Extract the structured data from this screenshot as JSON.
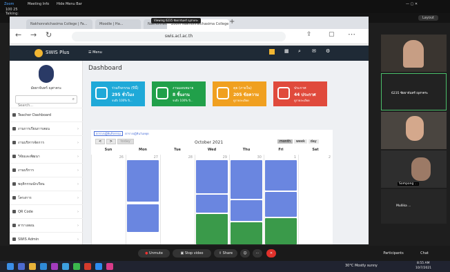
{
  "zoom": {
    "top_left_texts": [
      "Zoom",
      "Meeting Info",
      "Hide Menu Bar"
    ],
    "menu": [
      "Audio & Video",
      "Participant",
      "Meeting",
      "Help"
    ],
    "time_text": "100 25",
    "talking_label": "Talking:",
    "layout_button": "Layout"
  },
  "browser": {
    "tabs": [
      "Nakhonratchasima College | Fa...",
      "Moodle | Ha...",
      "Nakhonratchasima Co...",
      "Zoom Nakhonratchasima College"
    ],
    "url": "swis.acl.ac.th",
    "screen_banner": "Viewing 6235 ชัยยาจันทร์ ญุสาคระ"
  },
  "app": {
    "logo": "SWIS Plus",
    "menu_label": "Menu",
    "dashboard_title": "Dashboard",
    "user_name": "มัยยาจันทร์ ญุสาคระ",
    "search_placeholder": "Search...",
    "sidebar": [
      {
        "label": "Teacher Dashboard",
        "icon": "dashboard-icon"
      },
      {
        "label": "งานการเรียนการสอน",
        "icon": "book-icon"
      },
      {
        "label": "งานบริหารจัดการ",
        "icon": "grid-icon"
      },
      {
        "label": "วิจัยและพัฒนา",
        "icon": "doc-icon"
      },
      {
        "label": "งานบริการ",
        "icon": "list-icon"
      },
      {
        "label": "พฤติกรรมนักเรียน",
        "icon": "user-icon"
      },
      {
        "label": "โครงการ",
        "icon": "folder-icon"
      },
      {
        "label": "QR Code",
        "icon": "qr-icon"
      },
      {
        "label": "ตารางสอน",
        "icon": "calendar-icon"
      },
      {
        "label": "SWIS Admin",
        "icon": "gear-icon"
      }
    ]
  },
  "cards": [
    {
      "title": "ร่วมกิจกรรม (ปีนี้)",
      "value": "295 ชั่วโมง",
      "sub": "จบถึง 100% ปี...",
      "color": "#1fa9d8"
    },
    {
      "title": "งานมอบหมาย",
      "value": "8 ชิ้นงาน",
      "sub": "จบถึง 100% ปี...",
      "color": "#21a04a"
    },
    {
      "title": "คุย (ภายใน)",
      "value": "205 ข้อความ",
      "sub": "ดูรายละเอียด",
      "color": "#f0a020"
    },
    {
      "title": "ประกาศ",
      "value": "44 ประกาศ",
      "sub": "ดูรายละเอียด",
      "color": "#e04a3c"
    }
  ],
  "calendar": {
    "toggle": [
      "ตารางปฏิทินกิจกรรม",
      "ตารางปฏิทินวันหยุด"
    ],
    "nav": [
      "<",
      ">",
      "today"
    ],
    "month": "October 2021",
    "views": [
      "month",
      "week",
      "day"
    ],
    "days": [
      "Sun",
      "Mon",
      "Tue",
      "Wed",
      "Thu",
      "Fri",
      "Sat"
    ],
    "dates": [
      "26",
      "27",
      "28",
      "29",
      "30",
      "1",
      "2"
    ]
  },
  "participants": [
    {
      "name": "",
      "label": ""
    },
    {
      "name": "6235 ชัยยาจันทร์ ญุสาคระ",
      "label": ""
    },
    {
      "name": "",
      "label": ""
    },
    {
      "name": "Sompong ...",
      "label": ""
    },
    {
      "name": "Mullika ...",
      "label": ""
    }
  ],
  "controls": {
    "unmute": "Unmute",
    "video": "Stop video",
    "share": "Share",
    "participants": "Participants",
    "chat": "Chat"
  },
  "taskbar": {
    "weather": "30°C Mostly sunny",
    "time": "8:55 AM",
    "date": "10/7/2021"
  }
}
